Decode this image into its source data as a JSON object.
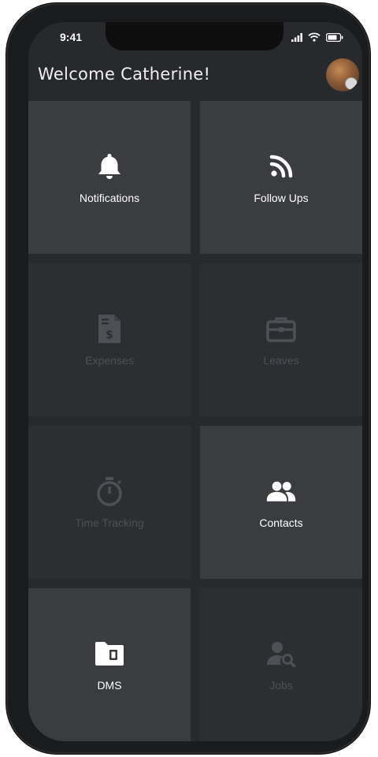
{
  "status_bar": {
    "time": "9:41"
  },
  "header": {
    "welcome": "Welcome Catherine!"
  },
  "tiles": [
    {
      "label": "Notifications",
      "icon": "bell-icon",
      "enabled": true
    },
    {
      "label": "Follow Ups",
      "icon": "rss-icon",
      "enabled": true
    },
    {
      "label": "Expenses",
      "icon": "invoice-icon",
      "enabled": false
    },
    {
      "label": "Leaves",
      "icon": "briefcase-icon",
      "enabled": false
    },
    {
      "label": "Time Tracking",
      "icon": "stopwatch-icon",
      "enabled": false
    },
    {
      "label": "Contacts",
      "icon": "users-icon",
      "enabled": true
    },
    {
      "label": "DMS",
      "icon": "folder-icon",
      "enabled": true
    },
    {
      "label": "Jobs",
      "icon": "user-search-icon",
      "enabled": false
    }
  ],
  "colors": {
    "screen_bg": "#27292d",
    "tile_active": "#3a3c40",
    "tile_inactive": "#2c2e32",
    "icon_active": "#ffffff",
    "icon_inactive": "#4d5055"
  }
}
